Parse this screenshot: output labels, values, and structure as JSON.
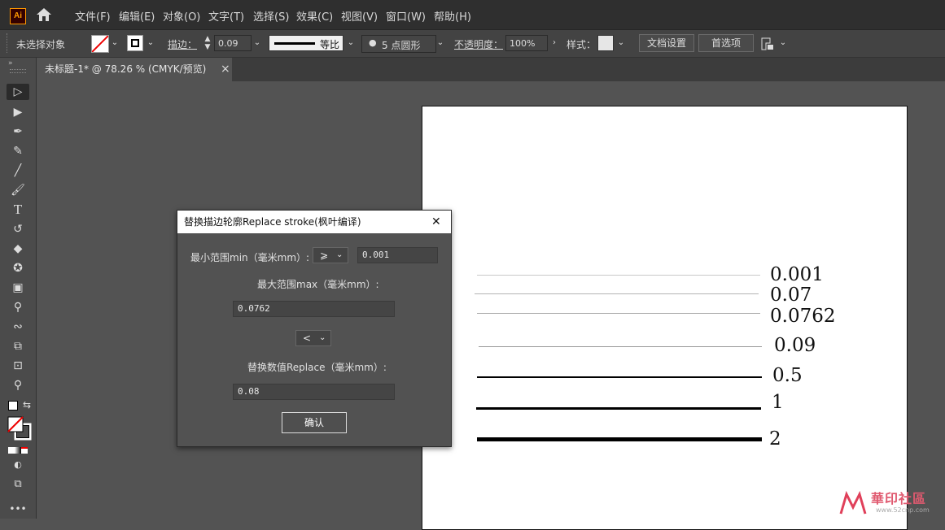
{
  "app": {
    "logo": "Ai"
  },
  "menu": [
    "文件(F)",
    "编辑(E)",
    "对象(O)",
    "文字(T)",
    "选择(S)",
    "效果(C)",
    "视图(V)",
    "窗口(W)",
    "帮助(H)"
  ],
  "control_bar": {
    "selection_status": "未选择对象",
    "stroke_label": "描边：",
    "stroke_weight": "0.09 mr",
    "stroke_profile": "等比",
    "brush_dot": "●",
    "brush": "5 点圆形",
    "opacity_label": "不透明度：",
    "opacity_value": "100%",
    "style_label": "样式：",
    "doc_setup": "文档设置",
    "preferences": "首选项"
  },
  "document_tab": {
    "title": "未标题-1* @ 78.26 % (CMYK/预览)",
    "close": "×"
  },
  "dialog": {
    "title": "替换描边轮廓Replace stroke(枫叶编译)",
    "close": "✕",
    "min_label": "最小范围min（毫米mm）:",
    "min_operator": "⩾",
    "min_value": "0.001",
    "max_label": "最大范围max（毫米mm）:",
    "max_value": "0.0762",
    "max_operator": "<",
    "replace_label": "替换数值Replace（毫米mm）:",
    "replace_value": "0.08",
    "ok": "确认"
  },
  "artboard_lines": [
    {
      "label": "0.001",
      "stroke": 0.001
    },
    {
      "label": "0.07",
      "stroke": 0.07
    },
    {
      "label": "0.0762",
      "stroke": 0.0762
    },
    {
      "label": "0.09",
      "stroke": 0.09
    },
    {
      "label": "0.5",
      "stroke": 0.5
    },
    {
      "label": "1",
      "stroke": 1
    },
    {
      "label": "2",
      "stroke": 2
    }
  ],
  "watermark": {
    "text": "華印社區",
    "sub": "www.52cnp.com"
  },
  "colors": {
    "menubar": "#2f2f2f",
    "control_bar": "#434343",
    "canvas": "#535353",
    "dialog": "#525252",
    "accent": "#ff9a00"
  }
}
